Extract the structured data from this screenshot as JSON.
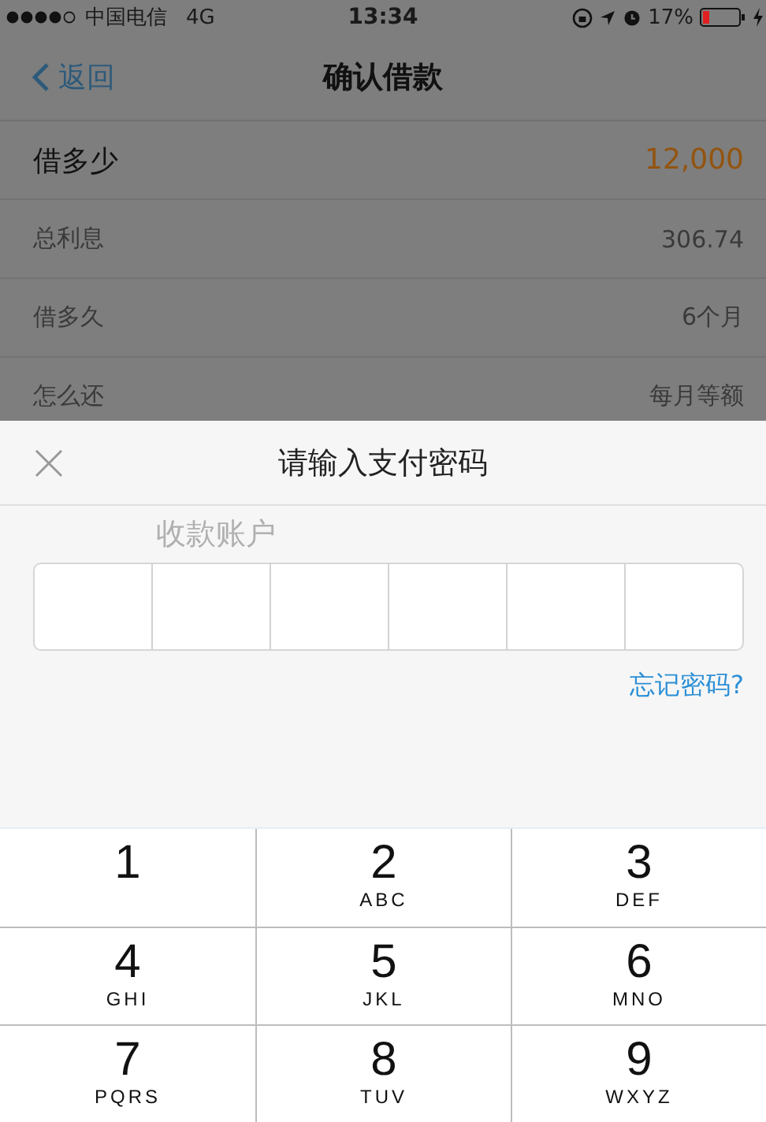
{
  "status_bar": {
    "carrier": "中国电信",
    "network": "4G",
    "time": "13:34",
    "battery": "17%"
  },
  "nav": {
    "back": "返回",
    "title": "确认借款"
  },
  "rows": [
    {
      "label": "借多少",
      "value": "12,000",
      "kind": "highlight"
    },
    {
      "label": "总利息",
      "value": "306.74",
      "kind": "plain"
    },
    {
      "label": "借多久",
      "value": "6个月",
      "kind": "plain"
    },
    {
      "label": "怎么还",
      "value": "每月等额",
      "kind": "plain"
    }
  ],
  "sheet": {
    "title": "请输入支付密码",
    "behind_label": "收款账户",
    "password_boxes": [
      {
        "filled": false
      },
      {
        "filled": false
      },
      {
        "filled": false
      },
      {
        "filled": false
      },
      {
        "filled": false
      },
      {
        "filled": false
      }
    ],
    "forgot": "忘记密码?"
  },
  "keypad": [
    {
      "digit": "1"
    },
    {
      "digit": "2",
      "letters": "ABC"
    },
    {
      "digit": "3",
      "letters": "DEF"
    },
    {
      "digit": "4",
      "letters": "GHI"
    },
    {
      "digit": "5",
      "letters": "JKL"
    },
    {
      "digit": "6",
      "letters": "MNO"
    },
    {
      "digit": "7",
      "letters": "PQRS"
    },
    {
      "digit": "8",
      "letters": "TUV"
    },
    {
      "digit": "9",
      "letters": "WXYZ"
    }
  ]
}
